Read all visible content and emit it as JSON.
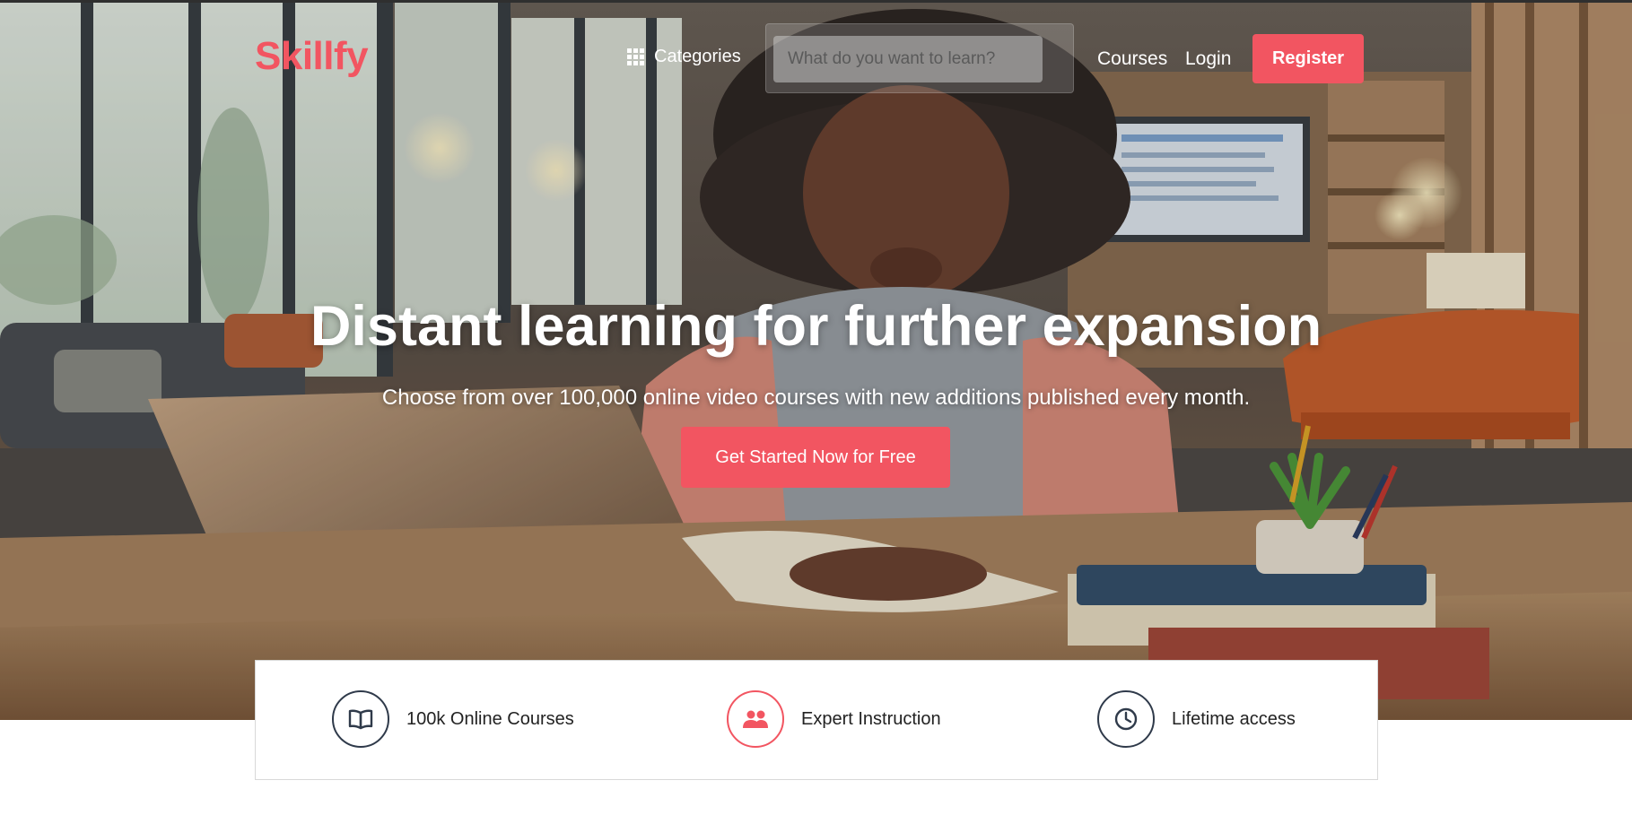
{
  "header": {
    "logo": "Skillfy",
    "categories_label": "Categories",
    "search_placeholder": "What do you want to learn?",
    "courses_link": "Courses",
    "login_link": "Login",
    "register_button": "Register"
  },
  "hero": {
    "title": "Distant learning for further expansion",
    "subtitle": "Choose from over 100,000 online video courses with new additions published every month.",
    "cta_button": "Get Started Now for Free"
  },
  "features": [
    {
      "icon": "book-icon",
      "label": "100k Online Courses"
    },
    {
      "icon": "users-icon",
      "label": "Expert Instruction"
    },
    {
      "icon": "clock-icon",
      "label": "Lifetime access"
    }
  ],
  "colors": {
    "brand": "#f25561",
    "icon_dark": "#2f3a4a"
  }
}
